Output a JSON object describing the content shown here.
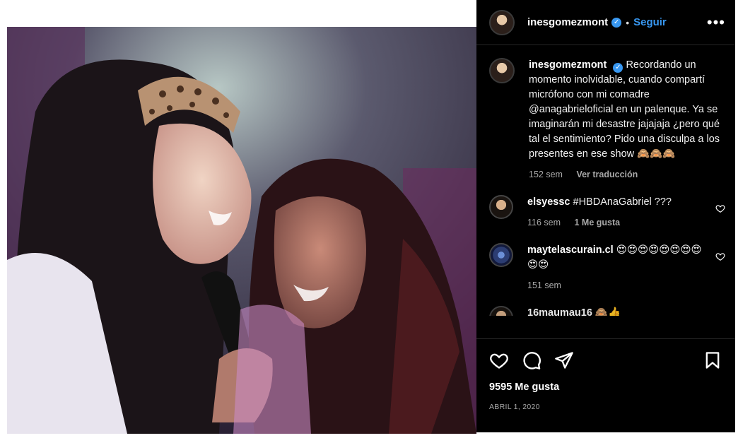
{
  "post": {
    "author": "inesgomezmont",
    "follow_label": "Seguir",
    "dot": "•",
    "more_label": "•••",
    "verified_mark": "✓",
    "caption": {
      "user": "inesgomezmont",
      "text": "Recordando un momento inolvidable, cuando compartí micrófono con mi comadre @anagabrieloficial en un palenque. Ya se imaginarán mi desastre jajajaja ¿pero qué tal el sentimiento? Pido una disculpa a los presentes en ese show 🙈🙈🙈",
      "time": "152 sem",
      "translate": "Ver traducción"
    },
    "comments": [
      {
        "user": "elsyessc",
        "text": "#HBDAnaGabriel ???",
        "time": "116 sem",
        "likes": "1 Me gusta"
      },
      {
        "user": "maytelascurain.cl",
        "text": "😍😍😍😍😍😍😍😍😍😍",
        "time": "151 sem"
      },
      {
        "user": "16maumau16",
        "text": "🙈👍"
      }
    ],
    "likes_count": "9595 Me gusta",
    "date": "ABRIL 1, 2020"
  },
  "icons": {
    "like": "heart-icon",
    "comment": "comment-icon",
    "share": "send-icon",
    "save": "bookmark-icon",
    "more": "more-icon"
  },
  "colors": {
    "panel_bg": "#000000",
    "link": "#3897f0",
    "muted": "#a8a8a8"
  }
}
